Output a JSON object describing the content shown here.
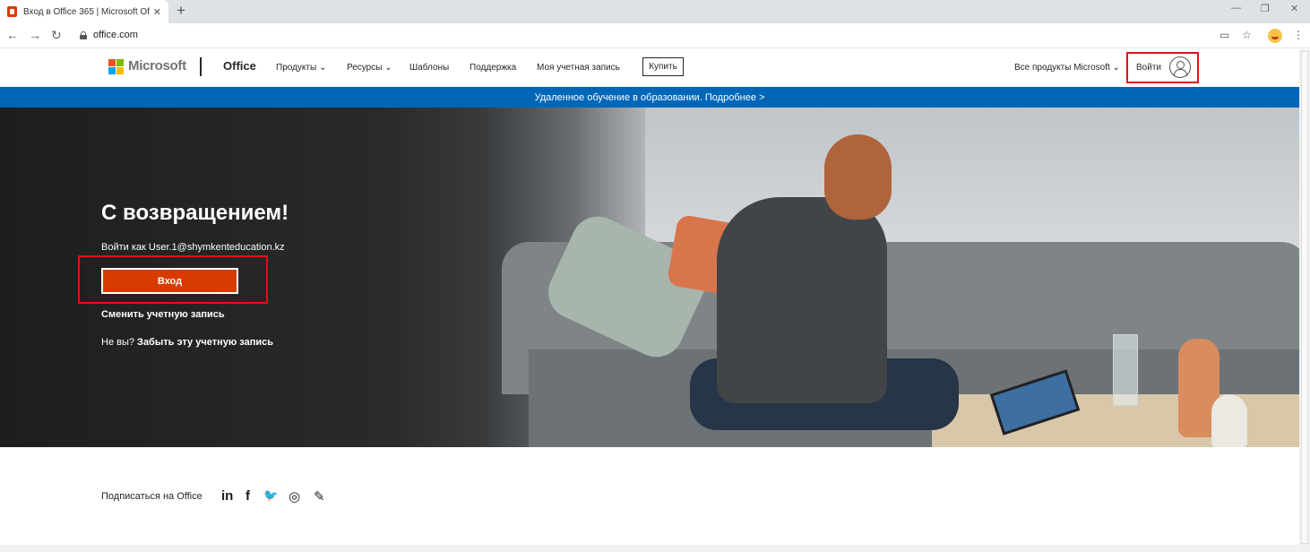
{
  "browser": {
    "tab_title": "Вход в Office 365 | Microsoft Off",
    "url": "office.com",
    "icons": [
      "office-favicon",
      "close-icon",
      "plus-icon",
      "back-icon",
      "forward-icon",
      "reload-icon",
      "lock-icon",
      "cast-icon",
      "star-icon",
      "profile-icon",
      "menu-icon"
    ]
  },
  "header": {
    "brand": "Microsoft",
    "product": "Office",
    "nav": {
      "products": "Продукты",
      "resources": "Ресурсы",
      "templates": "Шаблоны",
      "support": "Поддержка",
      "my_account": "Моя учетная запись"
    },
    "buy": "Купить",
    "all_products": "Все продукты Microsoft",
    "signin": "Войти"
  },
  "banner": {
    "text": "Удаленное обучение в образовании. Подробнее >"
  },
  "hero": {
    "title": "С возвращением!",
    "signin_as": "Войти как User.1@shymkenteducation.kz",
    "enter_button": "Вход",
    "switch_account": "Сменить учетную запись",
    "forget_prefix": "Не вы? ",
    "forget_link": "Забыть эту учетную запись"
  },
  "footer": {
    "subscribe": "Подписаться на Office",
    "social": {
      "linkedin": "in",
      "facebook": "f",
      "twitter": "🐦",
      "instagram": "◎",
      "blog": "✎"
    }
  },
  "colors": {
    "accent_blue": "#0067b8",
    "signin_orange": "#d83b01",
    "highlight_red": "#e3101a"
  }
}
